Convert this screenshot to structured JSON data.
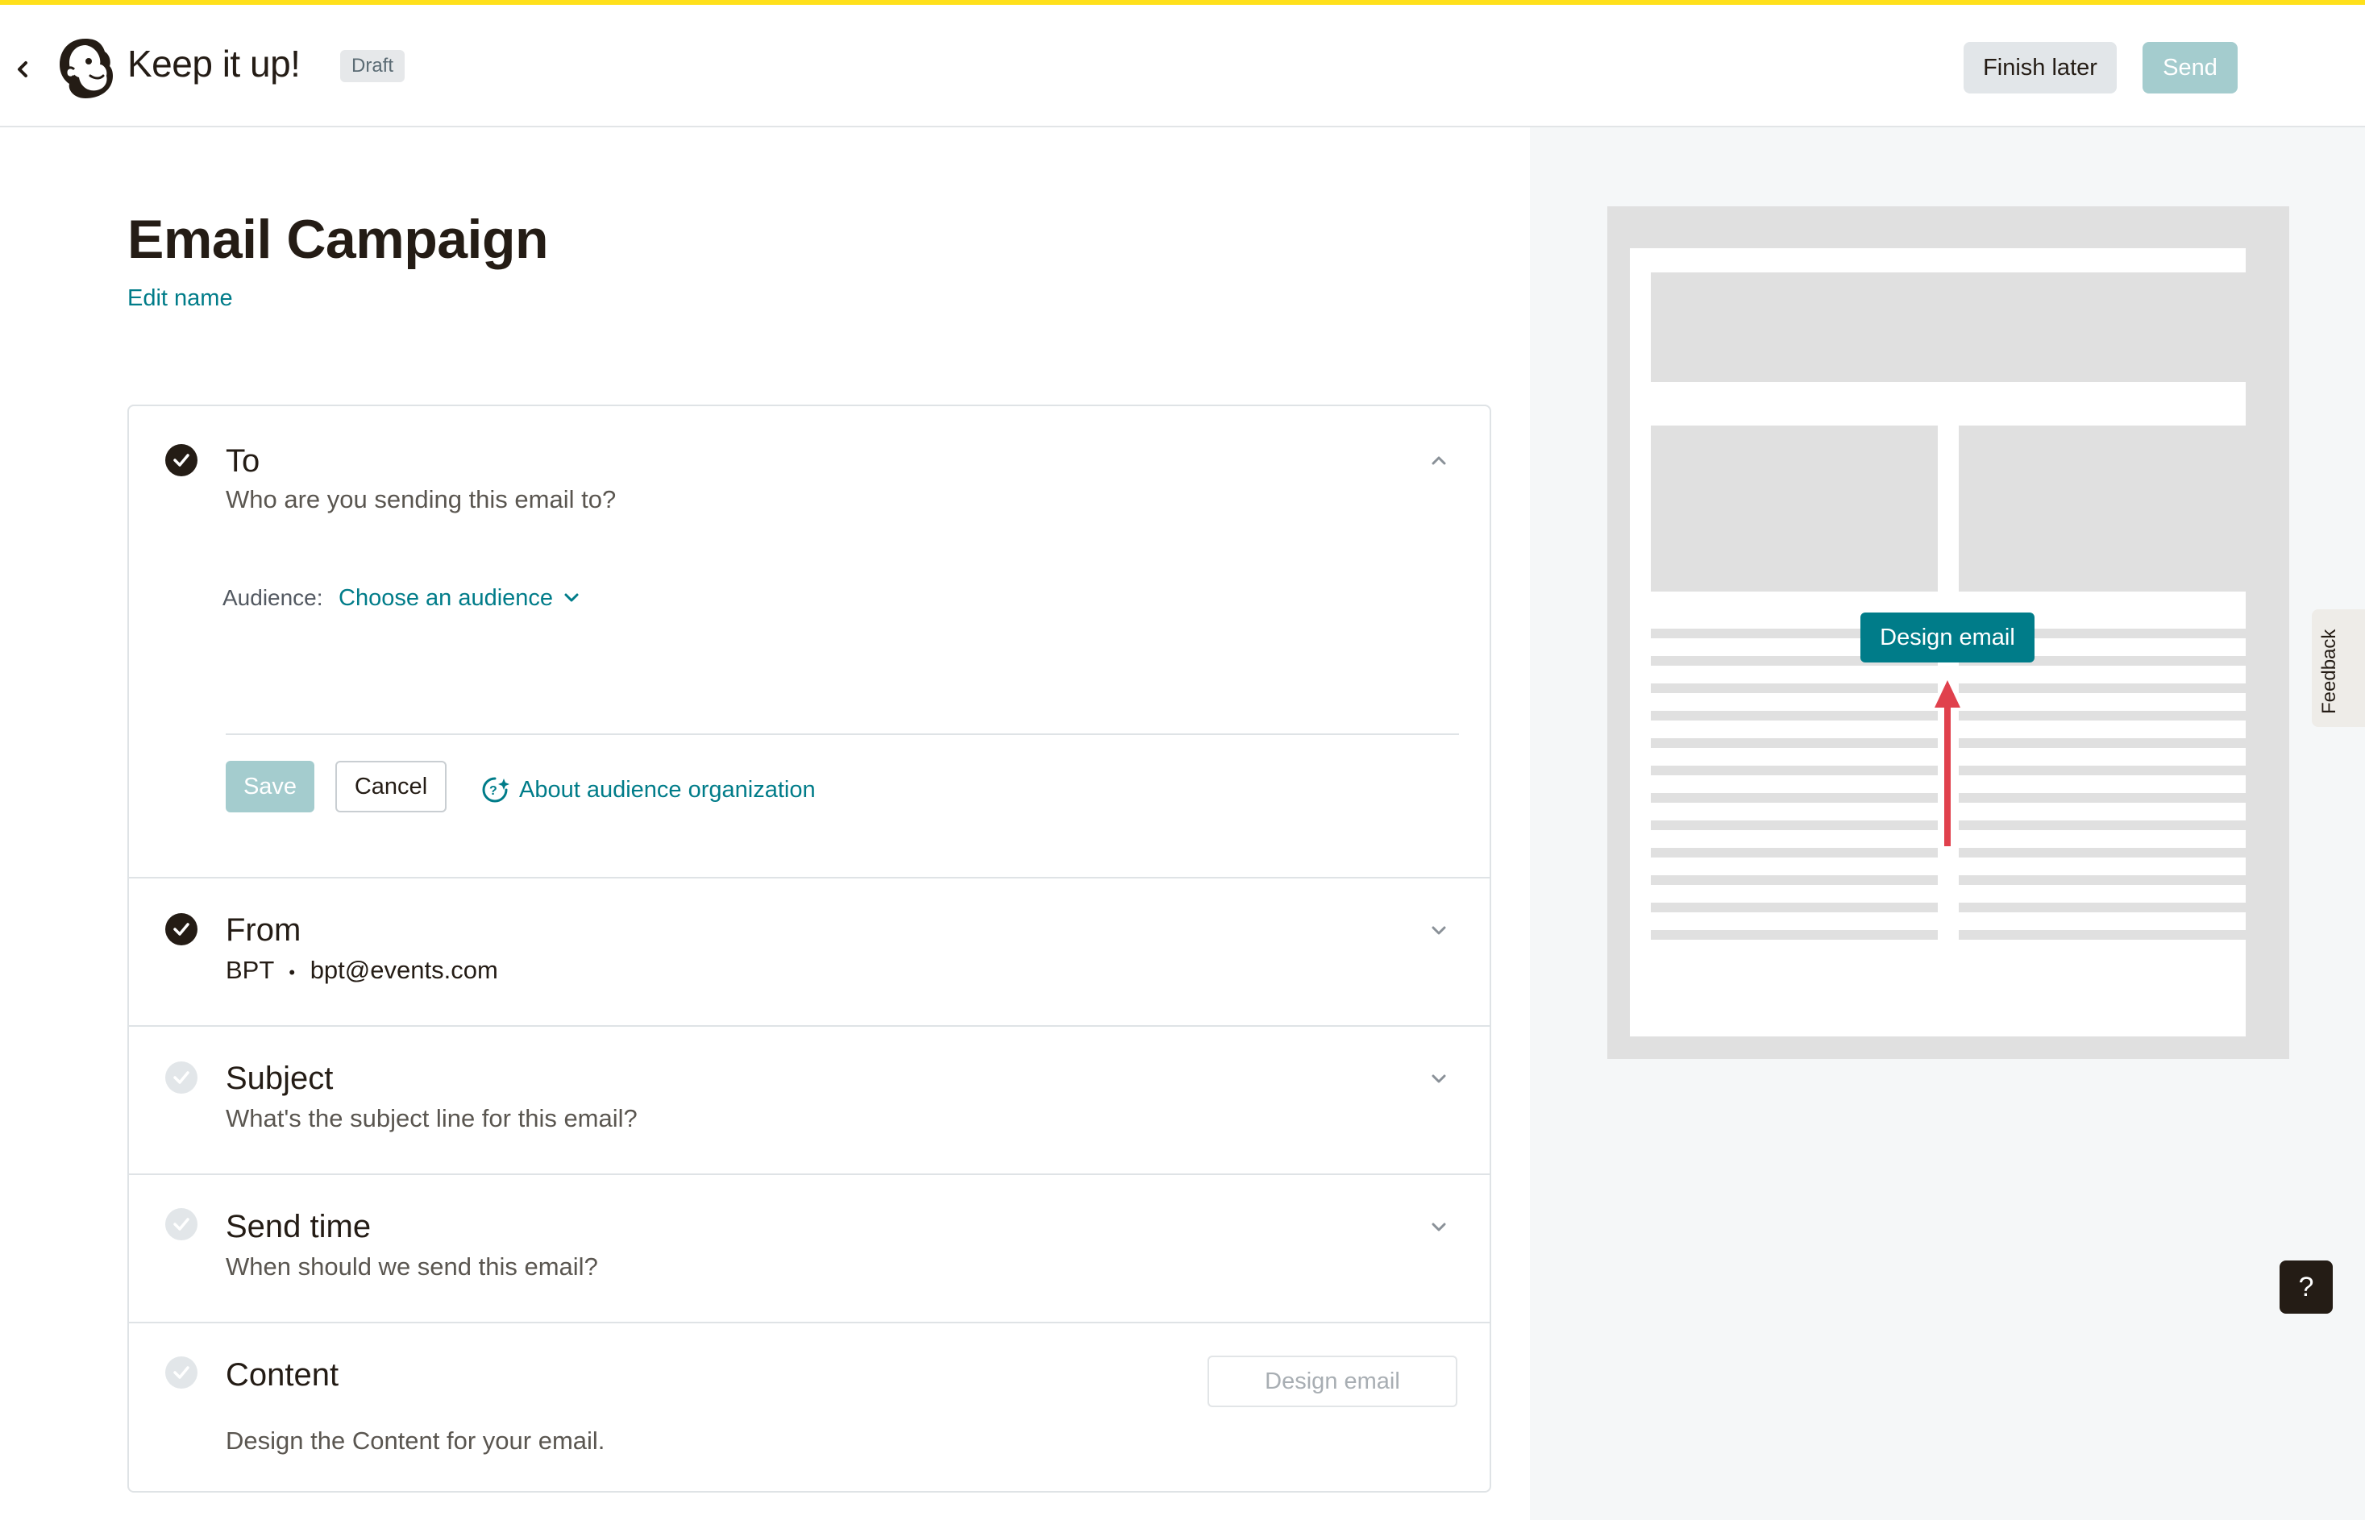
{
  "header": {
    "app_title": "Keep it up!",
    "status_badge": "Draft",
    "finish_later_label": "Finish later",
    "send_label": "Send"
  },
  "campaign": {
    "title": "Email Campaign",
    "edit_name_label": "Edit name"
  },
  "checklist": {
    "to": {
      "title": "To",
      "subtitle": "Who are you sending this email to?",
      "audience_label": "Audience:",
      "audience_value": "Choose an audience",
      "save_label": "Save",
      "cancel_label": "Cancel",
      "help_link": "About audience organization",
      "completed": true
    },
    "from": {
      "title": "From",
      "name": "BPT",
      "separator": "•",
      "email": "bpt@events.com",
      "completed": true
    },
    "subject": {
      "title": "Subject",
      "subtitle": "What's the subject line for this email?",
      "completed": false
    },
    "send_time": {
      "title": "Send time",
      "subtitle": "When should we send this email?",
      "completed": false
    },
    "content": {
      "title": "Content",
      "subtitle": "Design the Content for your email.",
      "design_button_label": "Design email",
      "completed": false
    }
  },
  "preview": {
    "design_email_label": "Design email"
  },
  "feedback_label": "Feedback",
  "help_label": "?",
  "colors": {
    "accent": "#007c89",
    "brand_yellow": "#ffe01b",
    "disabled_button": "#a4ccce",
    "annotation_arrow": "#e0414d"
  },
  "icons": {
    "back": "chevron-left-icon",
    "logo": "mailchimp-freddie-logo",
    "check": "check-circle-icon",
    "expand": "chevron-down-icon",
    "collapse": "chevron-up-icon",
    "help_link": "question-sparkle-icon"
  }
}
